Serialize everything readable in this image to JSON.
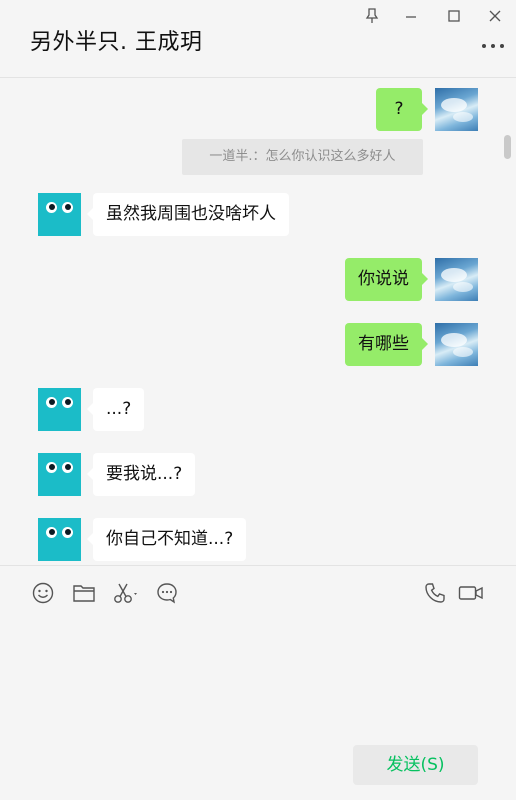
{
  "window": {
    "title": "另外半只. 王成玥",
    "controls": [
      "pin-icon",
      "minimize-icon",
      "maximize-icon",
      "close-icon"
    ],
    "more_icon": "more-icon"
  },
  "chat": {
    "messages": [
      {
        "side": "out",
        "type": "text",
        "text": "?"
      },
      {
        "side": "system",
        "type": "recall",
        "text": "一道半.：怎么你认识这么多好人"
      },
      {
        "side": "in",
        "type": "text",
        "text": "虽然我周围也没啥坏人"
      },
      {
        "side": "out",
        "type": "text",
        "text": "你说说"
      },
      {
        "side": "out",
        "type": "text",
        "text": "有哪些"
      },
      {
        "side": "in",
        "type": "text",
        "text": "...?"
      },
      {
        "side": "in",
        "type": "text",
        "text": "要我说...?"
      },
      {
        "side": "in",
        "type": "text",
        "text": "你自己不知道...?"
      }
    ]
  },
  "toolbar": {
    "left": [
      "emoji-icon",
      "folder-icon",
      "scissors-icon",
      "chat-bubble-icon"
    ],
    "right": [
      "phone-icon",
      "video-icon"
    ]
  },
  "composer": {
    "value": "",
    "send_label": "发送(S)"
  },
  "colors": {
    "outgoing_bubble": "#95ec69",
    "incoming_bubble": "#ffffff",
    "background": "#f5f5f5",
    "send_text": "#07c160",
    "avatar_teal": "#1bbcc8"
  }
}
